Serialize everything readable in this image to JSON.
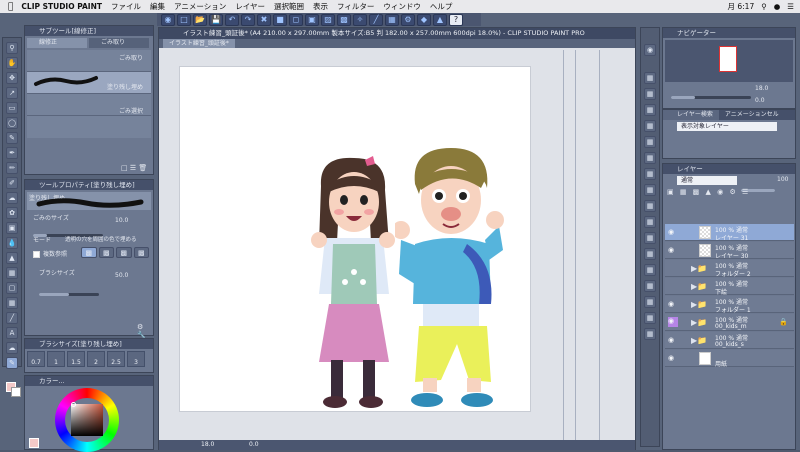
{
  "menubar": {
    "app_name": "CLIP STUDIO PAINT",
    "items": [
      "ファイル",
      "編集",
      "アニメーション",
      "レイヤー",
      "選択範囲",
      "表示",
      "フィルター",
      "ウィンドウ",
      "ヘルプ"
    ],
    "clock": "月 6:17"
  },
  "document": {
    "window_title": "イラスト練習_頭証後* (A4 210.00 x 297.00mm 製本サイズ:B5 判 182.00 x 257.00mm 600dpi 18.0%) - CLIP STUDIO PAINT PRO",
    "tab_label": "イラスト練習_頭証後*",
    "zoom": "18.0",
    "rotation": "0.0"
  },
  "subtool": {
    "title": "サブツール[線修正]",
    "tab_active": "線修正",
    "tab_other": "ごみ取り",
    "items": [
      "ごみ取り",
      "塗り残し埋め",
      "ごみ選択"
    ]
  },
  "toolprops": {
    "title": "ツールプロパティ[塗り残し埋め]",
    "preview_label": "塗り残し埋め",
    "dust_size_label": "ごみのサイズ",
    "dust_size_value": "10.0",
    "mode_label": "モード",
    "mode_value": "透明の穴を周囲の色で埋める",
    "multi_ref_label": "複数参照",
    "brush_size_label": "ブラシサイズ",
    "brush_size_value": "50.0"
  },
  "brushsize": {
    "title": "ブラシサイズ[塗り残し埋め]",
    "sizes": [
      "0.7",
      "1",
      "1.5",
      "2",
      "2.5",
      "3"
    ]
  },
  "color": {
    "title": "カラー..."
  },
  "navigator": {
    "title": "ナビゲーター",
    "zoom_value": "18.0",
    "rotate_value": "0.0"
  },
  "layer_search": {
    "title": "レイヤー検索",
    "tab_other": "アニメーションセル",
    "dropdown": "表示対象レイヤー"
  },
  "layers": {
    "title": "レイヤー",
    "blend_mode": "通常",
    "opacity": "100",
    "rows": [
      {
        "line1": "100 % 通常",
        "line2": "レイヤー 31",
        "kind": "layer",
        "visible": true,
        "selected": true
      },
      {
        "line1": "100 % 通常",
        "line2": "レイヤー 30",
        "kind": "layer",
        "visible": true,
        "selected": false
      },
      {
        "line1": "100 % 通常",
        "line2": "フォルダー 2",
        "kind": "folder",
        "visible": false,
        "selected": false
      },
      {
        "line1": "100 % 通常",
        "line2": "下絵",
        "kind": "folder",
        "visible": false,
        "selected": false
      },
      {
        "line1": "100 % 通常",
        "line2": "フォルダー 1",
        "kind": "folder",
        "visible": true,
        "selected": false
      },
      {
        "line1": "100 % 通常",
        "line2": "00_kids_m",
        "kind": "folder",
        "visible": true,
        "selected": false,
        "locked": true
      },
      {
        "line1": "100 % 通常",
        "line2": "00_kids_s",
        "kind": "folder",
        "visible": true,
        "selected": false
      },
      {
        "line1": "",
        "line2": "用紙",
        "kind": "paper",
        "visible": true,
        "selected": false
      }
    ]
  },
  "accent": {
    "selected_layer": "#8fa9d6",
    "canvas_bg": "#ffffff",
    "workspace": "#dfe2e8"
  }
}
